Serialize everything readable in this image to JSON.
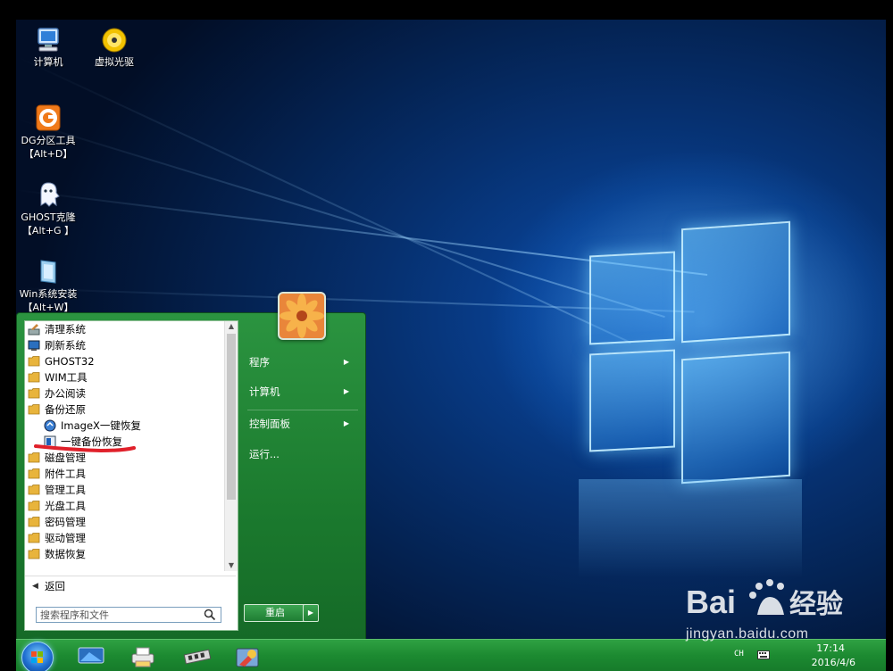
{
  "desktop": {
    "icons": [
      {
        "label": "计算机",
        "icon": "computer-icon"
      },
      {
        "label": "虚拟光驱",
        "icon": "virtual-drive-icon"
      },
      {
        "label": "DG分区工具",
        "sublabel": "【Alt+D】",
        "icon": "diskgenius-icon"
      },
      {
        "label": "GHOST克隆",
        "sublabel": "【Alt+G 】",
        "icon": "ghost-icon"
      },
      {
        "label": "Win系统安装",
        "sublabel": "【Alt+W】",
        "icon": "windows-installer-icon"
      }
    ]
  },
  "start_menu": {
    "programs": [
      {
        "label": "清理系统",
        "icon": "cleanup-icon"
      },
      {
        "label": "刷新系统",
        "icon": "refresh-system-icon"
      },
      {
        "label": "GHOST32",
        "icon": "folder-icon"
      },
      {
        "label": "WIM工具",
        "icon": "folder-icon"
      },
      {
        "label": "办公阅读",
        "icon": "folder-icon"
      },
      {
        "label": "备份还原",
        "icon": "folder-icon"
      },
      {
        "label": "ImageX一键恢复",
        "icon": "imagex-icon",
        "sub": true
      },
      {
        "label": "一键备份恢复",
        "icon": "backup-restore-icon",
        "sub": true
      },
      {
        "label": "磁盘管理",
        "icon": "folder-icon"
      },
      {
        "label": "附件工具",
        "icon": "folder-icon"
      },
      {
        "label": "管理工具",
        "icon": "folder-icon"
      },
      {
        "label": "光盘工具",
        "icon": "folder-icon"
      },
      {
        "label": "密码管理",
        "icon": "folder-icon"
      },
      {
        "label": "驱动管理",
        "icon": "folder-icon"
      },
      {
        "label": "数据恢复",
        "icon": "folder-icon"
      }
    ],
    "back_label": "返回",
    "search_placeholder": "搜索程序和文件",
    "right_items": [
      {
        "label": "程序",
        "has_submenu": true
      },
      {
        "label": "计算机",
        "has_submenu": true
      },
      {
        "label": "控制面板",
        "has_submenu": true
      },
      {
        "label": "运行...",
        "has_submenu": false
      }
    ],
    "shutdown_label": "重启"
  },
  "taskbar": {
    "pinned": [
      "display-icon",
      "printer-icon",
      "memory-icon",
      "tools-icon"
    ],
    "ime": "CH",
    "time": "17:14",
    "date": "2016/4/6"
  },
  "watermark": {
    "site": "jingyan.baidu.com"
  },
  "colors": {
    "menu_green": "#1b7a2e",
    "taskbar_green": "#1c8a31",
    "annotation_red": "#e0202a"
  }
}
